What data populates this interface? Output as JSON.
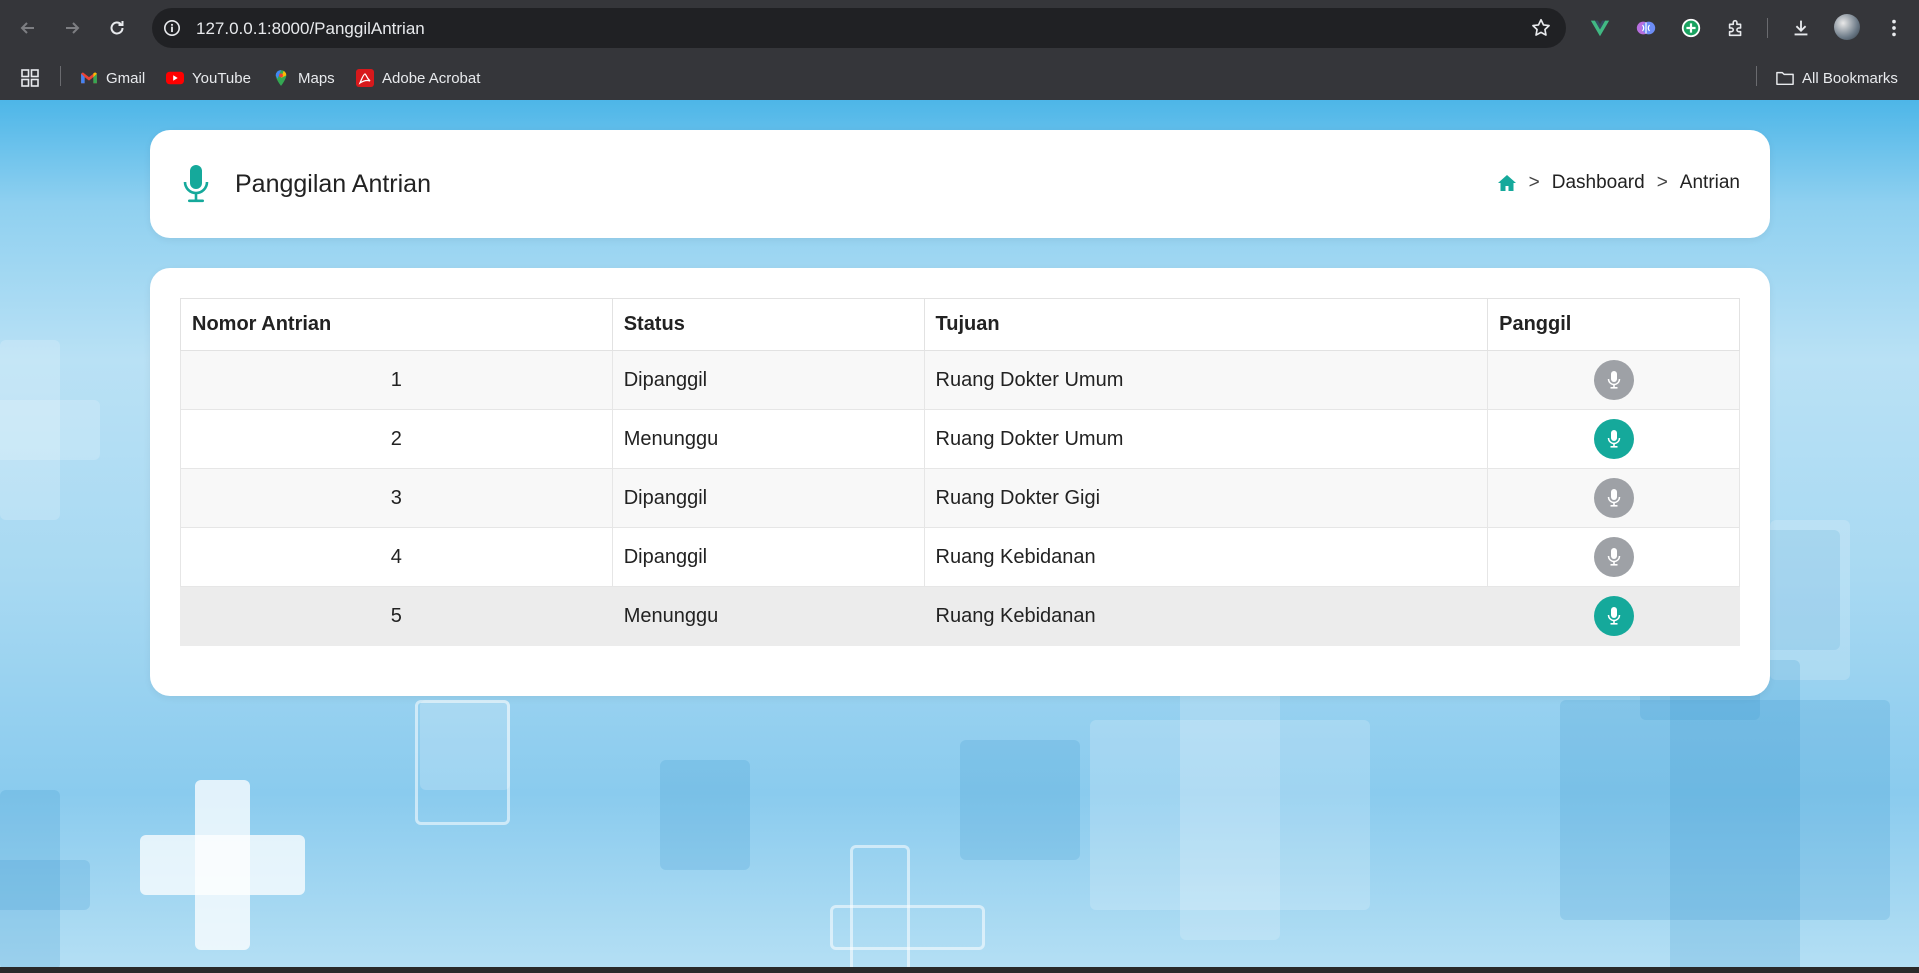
{
  "browser": {
    "url": "127.0.0.1:8000/PanggilAntrian",
    "bookmarks": [
      {
        "label": "Gmail",
        "icon": "gmail-icon"
      },
      {
        "label": "YouTube",
        "icon": "youtube-icon"
      },
      {
        "label": "Maps",
        "icon": "maps-icon"
      },
      {
        "label": "Adobe Acrobat",
        "icon": "acrobat-icon"
      }
    ],
    "all_bookmarks_label": "All Bookmarks"
  },
  "header": {
    "title": "Panggilan Antrian",
    "breadcrumb": {
      "separator": ">",
      "items": [
        "Dashboard",
        "Antrian"
      ]
    }
  },
  "table": {
    "columns": [
      "Nomor Antrian",
      "Status",
      "Tujuan",
      "Panggil"
    ],
    "rows": [
      {
        "nomor": "1",
        "status": "Dipanggil",
        "tujuan": "Ruang Dokter Umum",
        "button_state": "disabled"
      },
      {
        "nomor": "2",
        "status": "Menunggu",
        "tujuan": "Ruang Dokter Umum",
        "button_state": "active"
      },
      {
        "nomor": "3",
        "status": "Dipanggil",
        "tujuan": "Ruang Dokter Gigi",
        "button_state": "disabled"
      },
      {
        "nomor": "4",
        "status": "Dipanggil",
        "tujuan": "Ruang Kebidanan",
        "button_state": "disabled"
      },
      {
        "nomor": "5",
        "status": "Menunggu",
        "tujuan": "Ruang Kebidanan",
        "button_state": "active"
      }
    ]
  },
  "colors": {
    "accent": "#15a99b",
    "disabled_button": "#9ea1a6",
    "chrome_bg": "#35363a",
    "omnibox_bg": "#202124"
  }
}
